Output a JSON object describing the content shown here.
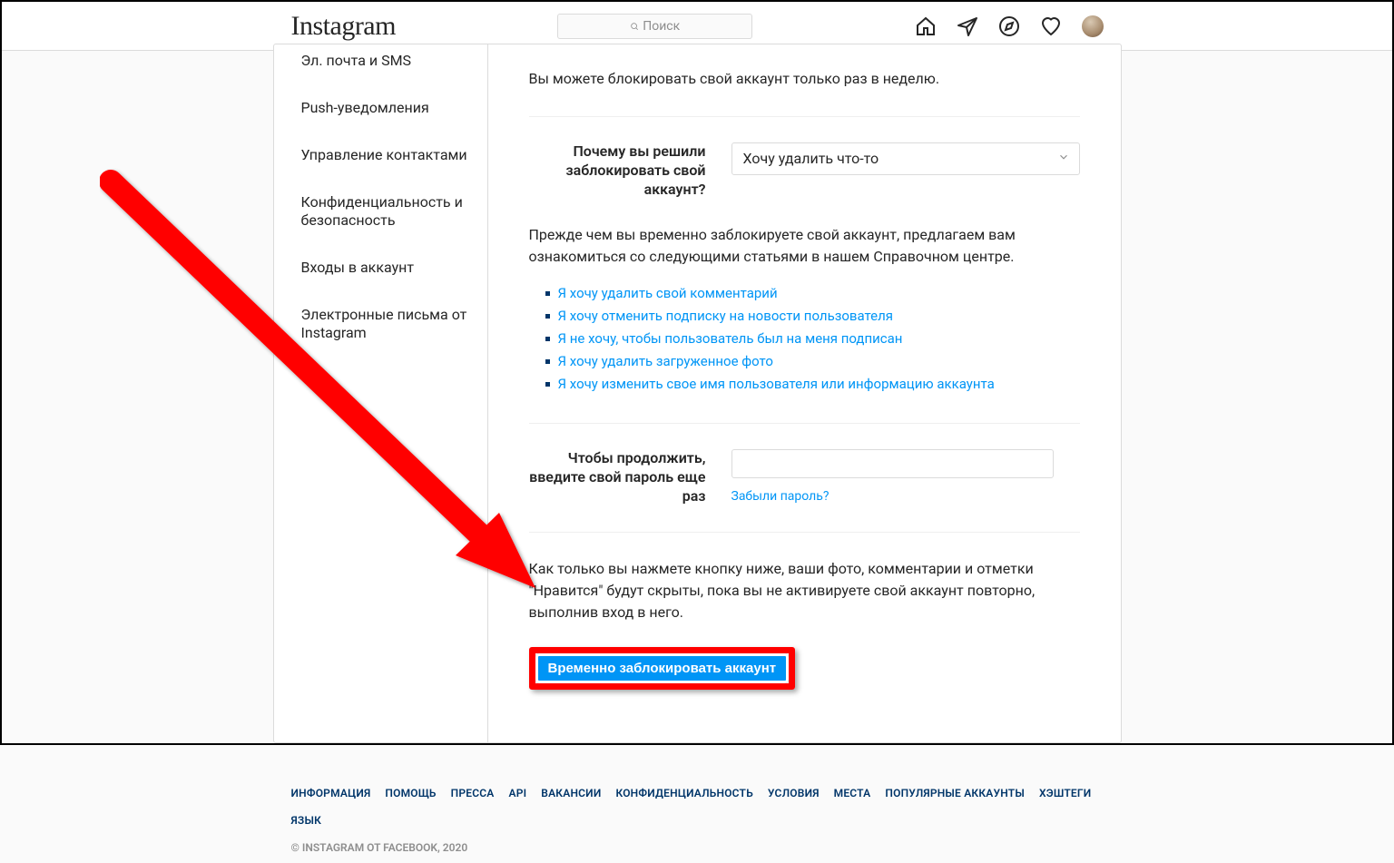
{
  "header": {
    "logo": "Instagram",
    "search_placeholder": "Поиск"
  },
  "sidebar": {
    "items": [
      "Эл. почта и SMS",
      "Push-уведомления",
      "Управление контактами",
      "Конфиденциальность и безопасность",
      "Входы в аккаунт",
      "Электронные письма от Instagram"
    ]
  },
  "main": {
    "note": "Вы можете блокировать свой аккаунт только раз в неделю.",
    "reason_label": "Почему вы решили заблокировать свой аккаунт?",
    "reason_selected": "Хочу удалить что-то",
    "help_intro": "Прежде чем вы временно заблокируете свой аккаунт, предлагаем вам ознакомиться со следующими статьями в нашем Справочном центре.",
    "help_links": [
      "Я хочу удалить свой комментарий",
      "Я хочу отменить подписку на новости пользователя",
      "Я не хочу, чтобы пользователь был на меня подписан",
      "Я хочу удалить загруженное фото",
      "Я хочу изменить свое имя пользователя или информацию аккаунта"
    ],
    "password_label": "Чтобы продолжить, введите свой пароль еще раз",
    "forgot_password": "Забыли пароль?",
    "final_warning": "Как только вы нажмете кнопку ниже, ваши фото, комментарии и отметки \"Нравится\" будут скрыты, пока вы не активируете свой аккаунт повторно, выполнив вход в него.",
    "submit_label": "Временно заблокировать аккаунт"
  },
  "footer": {
    "links": [
      "ИНФОРМАЦИЯ",
      "ПОМОЩЬ",
      "ПРЕССА",
      "API",
      "ВАКАНСИИ",
      "КОНФИДЕНЦИАЛЬНОСТЬ",
      "УСЛОВИЯ",
      "МЕСТА",
      "ПОПУЛЯРНЫЕ АККАУНТЫ",
      "ХЭШТЕГИ",
      "ЯЗЫК"
    ],
    "copyright": "© INSTAGRAM ОТ FACEBOOK, 2020"
  }
}
